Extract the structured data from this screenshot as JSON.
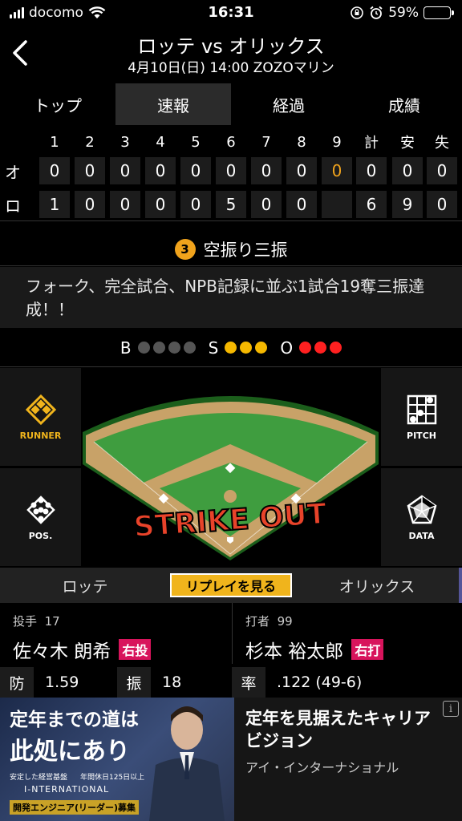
{
  "status_bar": {
    "carrier": "docomo",
    "time": "16:31",
    "battery": "59%",
    "battery_level": 0.59
  },
  "header": {
    "title": "ロッテ vs オリックス",
    "subtitle": "4月10日(日) 14:00 ZOZOマリン"
  },
  "tabs": [
    {
      "label": "トップ",
      "active": false
    },
    {
      "label": "速報",
      "active": true
    },
    {
      "label": "経過",
      "active": false
    },
    {
      "label": "成績",
      "active": false
    }
  ],
  "scoreboard": {
    "headers": [
      "1",
      "2",
      "3",
      "4",
      "5",
      "6",
      "7",
      "8",
      "9",
      "計",
      "安",
      "失"
    ],
    "rows": [
      {
        "team": "オ",
        "cells": [
          "0",
          "0",
          "0",
          "0",
          "0",
          "0",
          "0",
          "0",
          "0",
          "0",
          "0",
          "0"
        ]
      },
      {
        "team": "ロ",
        "cells": [
          "1",
          "0",
          "0",
          "0",
          "0",
          "5",
          "0",
          "0",
          "",
          "6",
          "9",
          "0"
        ]
      }
    ]
  },
  "play": {
    "number": "3",
    "result": "空振り三振",
    "description": "フォーク、完全試合、NPB記録に並ぶ1試合19奪三振達成！！"
  },
  "count": {
    "balls_label": "B",
    "balls": 0,
    "balls_max": 4,
    "strikes_label": "S",
    "strikes": 3,
    "strikes_max": 3,
    "outs_label": "O",
    "outs": 3,
    "outs_max": 3
  },
  "field": {
    "runner_label": "RUNNER",
    "pos_label": "POS.",
    "pitch_label": "PITCH",
    "data_label": "DATA",
    "overlay_text": "STRIKE OUT"
  },
  "teams_bar": {
    "home": "ロッテ",
    "replay": "リプレイを見る",
    "away": "オリックス"
  },
  "pitcher": {
    "role": "投手",
    "number": "17",
    "name": "佐々木 朗希",
    "hand": "右投",
    "stats": [
      {
        "k": "防",
        "v": "1.59"
      },
      {
        "k": "振",
        "v": "18"
      }
    ]
  },
  "batter": {
    "role": "打者",
    "number": "99",
    "name": "杉本 裕太郎",
    "hand": "右打",
    "stats": [
      {
        "k": "率",
        "v": ".122 (49-6)"
      }
    ]
  },
  "ad": {
    "image_head1": "定年までの道は",
    "image_head2": "此処にあり",
    "image_small1": "安定した経営基盤",
    "image_small2": "年間休日125日以上",
    "image_logo": "I-NTERNATIONAL",
    "image_bottom": "開発エンジニア(リーダー)募集",
    "title": "定年を見据えたキャリアビジョン",
    "brand": "アイ・インターナショナル",
    "info_icon": "i"
  },
  "colors": {
    "ball": "#555555",
    "strike": "#f5b800",
    "out": "#ff2020",
    "badge": "#f0a31c",
    "hand": "#d8145c",
    "replay": "#f0b41c"
  }
}
